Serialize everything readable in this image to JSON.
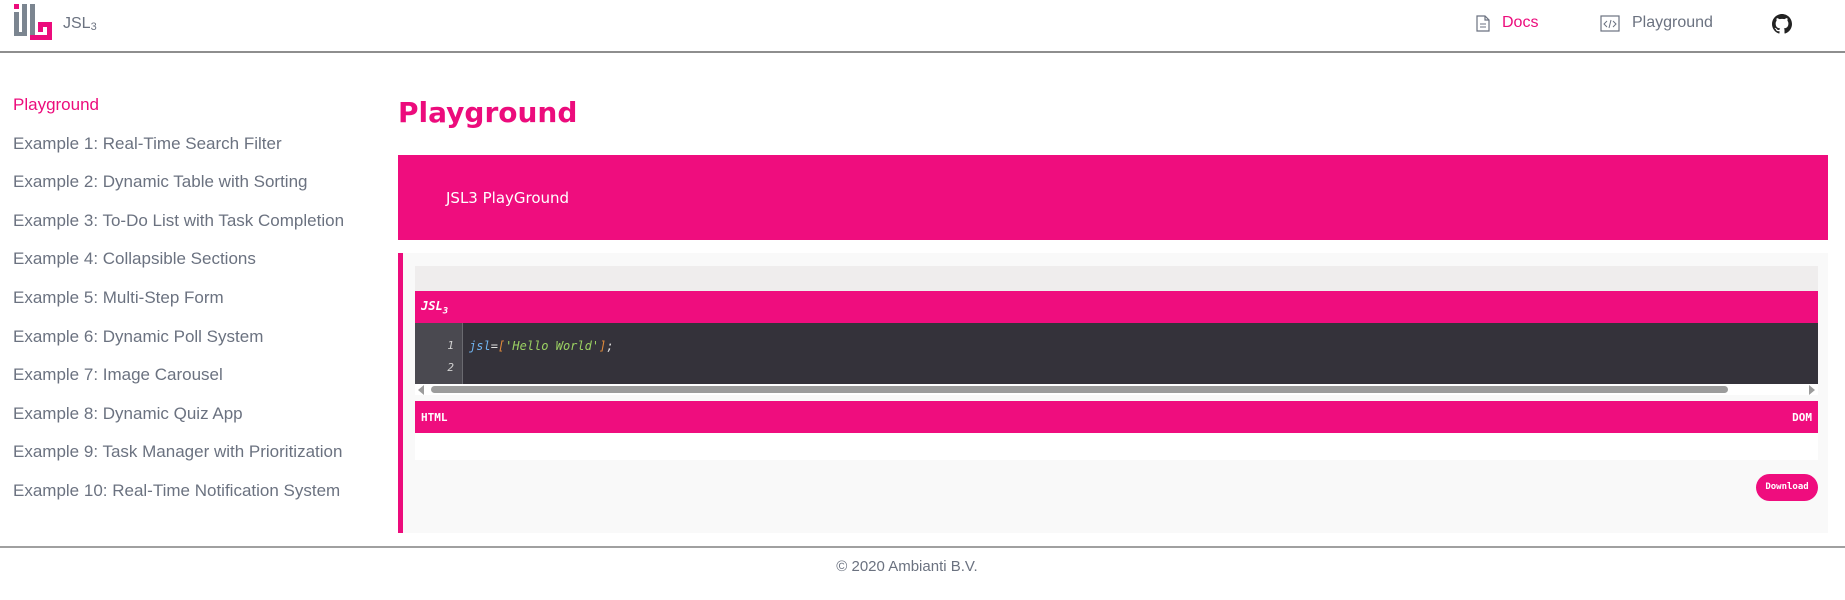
{
  "header": {
    "brand": "JSL",
    "brand_sub": "3",
    "nav": {
      "docs_label": "Docs",
      "playground_label": "Playground"
    },
    "icons": [
      "jsl-logo-icon",
      "document-icon",
      "code-icon",
      "github-icon"
    ]
  },
  "sidebar": {
    "items": [
      {
        "label": "Playground",
        "active": true
      },
      {
        "label": "Example 1: Real-Time Search Filter"
      },
      {
        "label": "Example 2: Dynamic Table with Sorting"
      },
      {
        "label": "Example 3: To-Do List with Task Completion"
      },
      {
        "label": "Example 4: Collapsible Sections"
      },
      {
        "label": "Example 5: Multi-Step Form"
      },
      {
        "label": "Example 6: Dynamic Poll System"
      },
      {
        "label": "Example 7: Image Carousel"
      },
      {
        "label": "Example 8: Dynamic Quiz App"
      },
      {
        "label": "Example 9: Task Manager with Prioritization"
      },
      {
        "label": "Example 10: Real-Time Notification System"
      }
    ]
  },
  "main": {
    "title": "Playground",
    "banner_text": "JSL3 PlayGround",
    "editor": {
      "label": "JSL",
      "label_sub": "3",
      "line_numbers": [
        "1",
        "2"
      ],
      "code": {
        "var": "jsl",
        "op": "=",
        "open": "[",
        "str": "'Hello World'",
        "close": "]",
        "end": ";"
      }
    },
    "output": {
      "left_label": "HTML",
      "right_label": "DOM"
    },
    "download_label": "Download"
  },
  "footer": {
    "text": "© 2020 Ambianti B.V."
  },
  "colors": {
    "accent": "#ec0c7c",
    "text": "#6b7280",
    "editor_bg": "#34323a"
  }
}
